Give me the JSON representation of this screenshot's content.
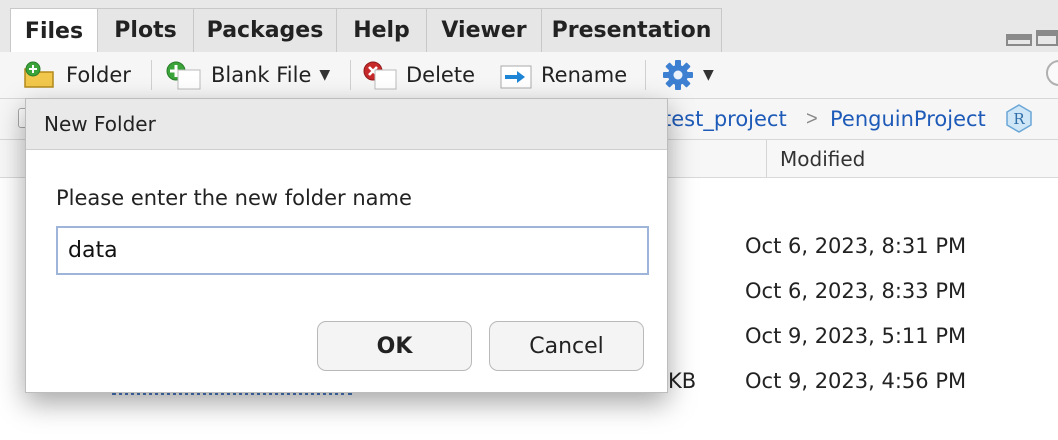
{
  "tabs": [
    {
      "label": "Files",
      "active": true
    },
    {
      "label": "Plots"
    },
    {
      "label": "Packages"
    },
    {
      "label": "Help"
    },
    {
      "label": "Viewer"
    },
    {
      "label": "Presentation"
    }
  ],
  "toolbar": {
    "new_folder_label": "Folder",
    "new_file_label": "Blank File",
    "delete_label": "Delete",
    "rename_label": "Rename",
    "icons": {
      "new_folder": "folder-plus-icon",
      "new_file": "add-circle-icon",
      "delete": "delete-circle-icon",
      "rename": "rename-icon",
      "more": "gear-icon"
    },
    "colors": {
      "add_green": "#3aa33a",
      "delete_red": "#c72a2a",
      "gear_blue": "#3d7fd1"
    }
  },
  "breadcrumb": {
    "items": [
      "test_project",
      "PenguinProject"
    ],
    "separator": ">",
    "project_badge": "R"
  },
  "table": {
    "modified_header": "Modified",
    "rows": [
      {
        "modified": "Oct 6, 2023, 8:31 PM"
      },
      {
        "modified": "Oct 6, 2023, 8:33 PM"
      },
      {
        "modified": "Oct 9, 2023, 5:11 PM"
      },
      {
        "modified": "Oct 9, 2023, 4:56 PM",
        "size_fragment": "KB"
      }
    ]
  },
  "dialog": {
    "title": "New Folder",
    "prompt": "Please enter the new folder name",
    "input_value": "data",
    "ok_label": "OK",
    "cancel_label": "Cancel"
  }
}
